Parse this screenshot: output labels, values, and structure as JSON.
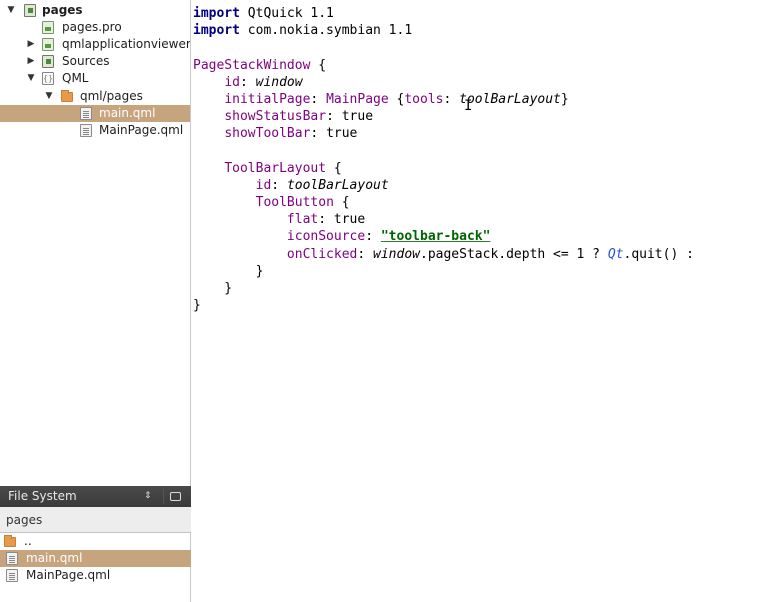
{
  "project_tree": {
    "items": [
      {
        "arrow": "▼",
        "icon": "project-icon",
        "label": "pages",
        "bold": true
      },
      {
        "arrow": "",
        "icon": "pro-file-icon",
        "label": "pages.pro"
      },
      {
        "arrow": "▶",
        "icon": "pro-file-icon",
        "label": "qmlapplicationviewer"
      },
      {
        "arrow": "▶",
        "icon": "folder-icon",
        "label": "Sources"
      },
      {
        "arrow": "▼",
        "icon": "qml-group-icon",
        "label": "QML"
      },
      {
        "arrow": "▼",
        "icon": "folder-icon",
        "label": "qml/pages"
      },
      {
        "arrow": "",
        "icon": "qml-file-icon",
        "label": "main.qml",
        "selected": true
      },
      {
        "arrow": "",
        "icon": "qml-file-icon",
        "label": "MainPage.qml"
      }
    ]
  },
  "file_system": {
    "title": "File System",
    "sel_arrows": "⇕",
    "breadcrumb": "pages",
    "items": [
      {
        "icon": "folder-icon",
        "label": ".."
      },
      {
        "icon": "qml-file-icon",
        "label": "main.qml",
        "selected": true
      },
      {
        "icon": "qml-file-icon",
        "label": "MainPage.qml"
      }
    ]
  },
  "editor": {
    "line1": {
      "kw": "import",
      "rest": " QtQuick 1.1"
    },
    "line2": {
      "kw": "import",
      "rest": " com.nokia.symbian 1.1"
    },
    "line4": {
      "type": "PageStackWindow",
      "rest": " {"
    },
    "line5": {
      "indent": "    ",
      "prop": "id",
      "sep": ": ",
      "val": "window"
    },
    "line6": {
      "indent": "    ",
      "prop": "initialPage",
      "sep": ": ",
      "type": "MainPage",
      "mid": " {",
      "prop2": "tools",
      "sep2": ": ",
      "val": "toolBarLayout",
      "end": "}"
    },
    "line7": {
      "indent": "    ",
      "prop": "showStatusBar",
      "sep": ": ",
      "val": "true"
    },
    "line8": {
      "indent": "    ",
      "prop": "showToolBar",
      "sep": ": ",
      "val": "true"
    },
    "line10": {
      "indent": "    ",
      "type": "ToolBarLayout",
      "rest": " {"
    },
    "line11": {
      "indent": "        ",
      "prop": "id",
      "sep": ": ",
      "val": "toolBarLayout"
    },
    "line12": {
      "indent": "        ",
      "type": "ToolButton",
      "rest": " {"
    },
    "line13": {
      "indent": "            ",
      "prop": "flat",
      "sep": ": ",
      "val": "true"
    },
    "line14": {
      "indent": "            ",
      "prop": "iconSource",
      "sep": ": ",
      "str": "\"toolbar-back\""
    },
    "line15": {
      "indent": "            ",
      "prop": "onClicked",
      "sep": ": ",
      "obj": "window",
      "mid": ".pageStack.depth <= 1 ? ",
      "qt": "Qt",
      "end": ".quit() :"
    },
    "line16": {
      "text": "        }"
    },
    "line17": {
      "text": "    }"
    },
    "line18": {
      "text": "}"
    },
    "cursor_glyph": "I"
  }
}
